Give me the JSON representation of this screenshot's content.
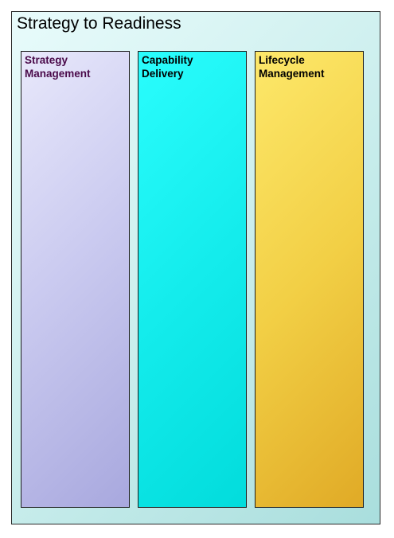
{
  "diagram": {
    "title": "Strategy to Readiness",
    "lanes": [
      {
        "label": "Strategy\nManagement",
        "colors": {
          "top": "#e8e8fb",
          "bottom": "#a8a8de",
          "text": "#4a0a4a"
        }
      },
      {
        "label": "Capability\nDelivery",
        "colors": {
          "top": "#2afdfd",
          "bottom": "#02dcdc",
          "text": "#000000"
        }
      },
      {
        "label": "Lifecycle\nManagement",
        "colors": {
          "top": "#fde86a",
          "bottom": "#e0aa26",
          "text": "#000000"
        }
      }
    ],
    "frame_colors": {
      "top": "#e8fbfb",
      "bottom": "#a9dedd",
      "border": "#2a2a2a"
    }
  }
}
